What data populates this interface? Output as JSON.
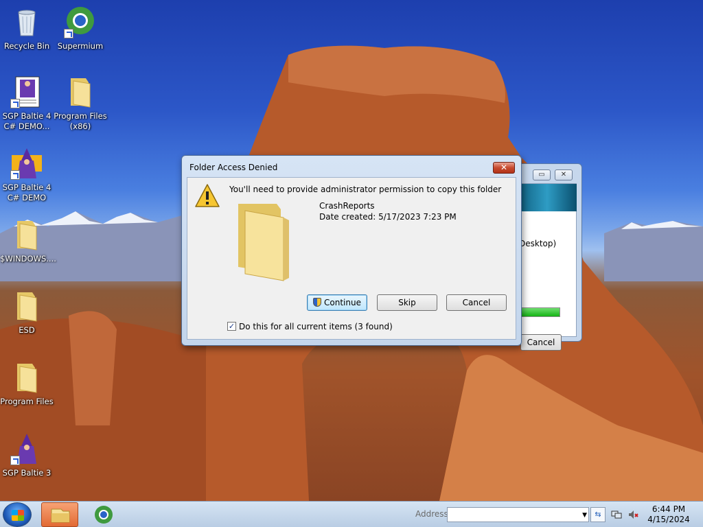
{
  "desktop": {
    "icons": [
      {
        "label": "Recycle Bin",
        "icon": "recycle-bin-icon"
      },
      {
        "label": "Supermium",
        "icon": "supermium-icon"
      },
      {
        "label": "SGP Baltie 4 C# DEMO...",
        "icon": "baltie-doc-icon"
      },
      {
        "label": "Program Files (x86)",
        "icon": "folder-icon"
      },
      {
        "label": "SGP Baltie 4 C# DEMO",
        "icon": "baltie-wizard-icon"
      },
      {
        "label": "$WINDOWS....",
        "icon": "folder-icon"
      },
      {
        "label": "ESD",
        "icon": "folder-icon"
      },
      {
        "label": "Program Files",
        "icon": "folder-icon"
      },
      {
        "label": "SGP Baltie 3",
        "icon": "baltie-wizard-icon"
      }
    ]
  },
  "background_window": {
    "path_fragment": "Desktop)",
    "cancel_label": "Cancel",
    "progress": 1.0
  },
  "dialog": {
    "title": "Folder Access Denied",
    "close_glyph": "✕",
    "message": "You'll need to provide administrator permission to copy this folder",
    "folder_name": "CrashReports",
    "date_created": "Date created: 5/17/2023 7:23 PM",
    "buttons": {
      "continue": "Continue",
      "skip": "Skip",
      "cancel": "Cancel"
    },
    "checkbox_label": "Do this for all current items (3 found)",
    "checkbox_checked": true
  },
  "taskbar": {
    "address_label": "Address",
    "address_value": "",
    "time": "6:44 PM",
    "date": "4/15/2024"
  },
  "colors": {
    "dialog_frame": "#c3d5ec",
    "close_button": "#c74a2f",
    "progress": "#14b214"
  }
}
